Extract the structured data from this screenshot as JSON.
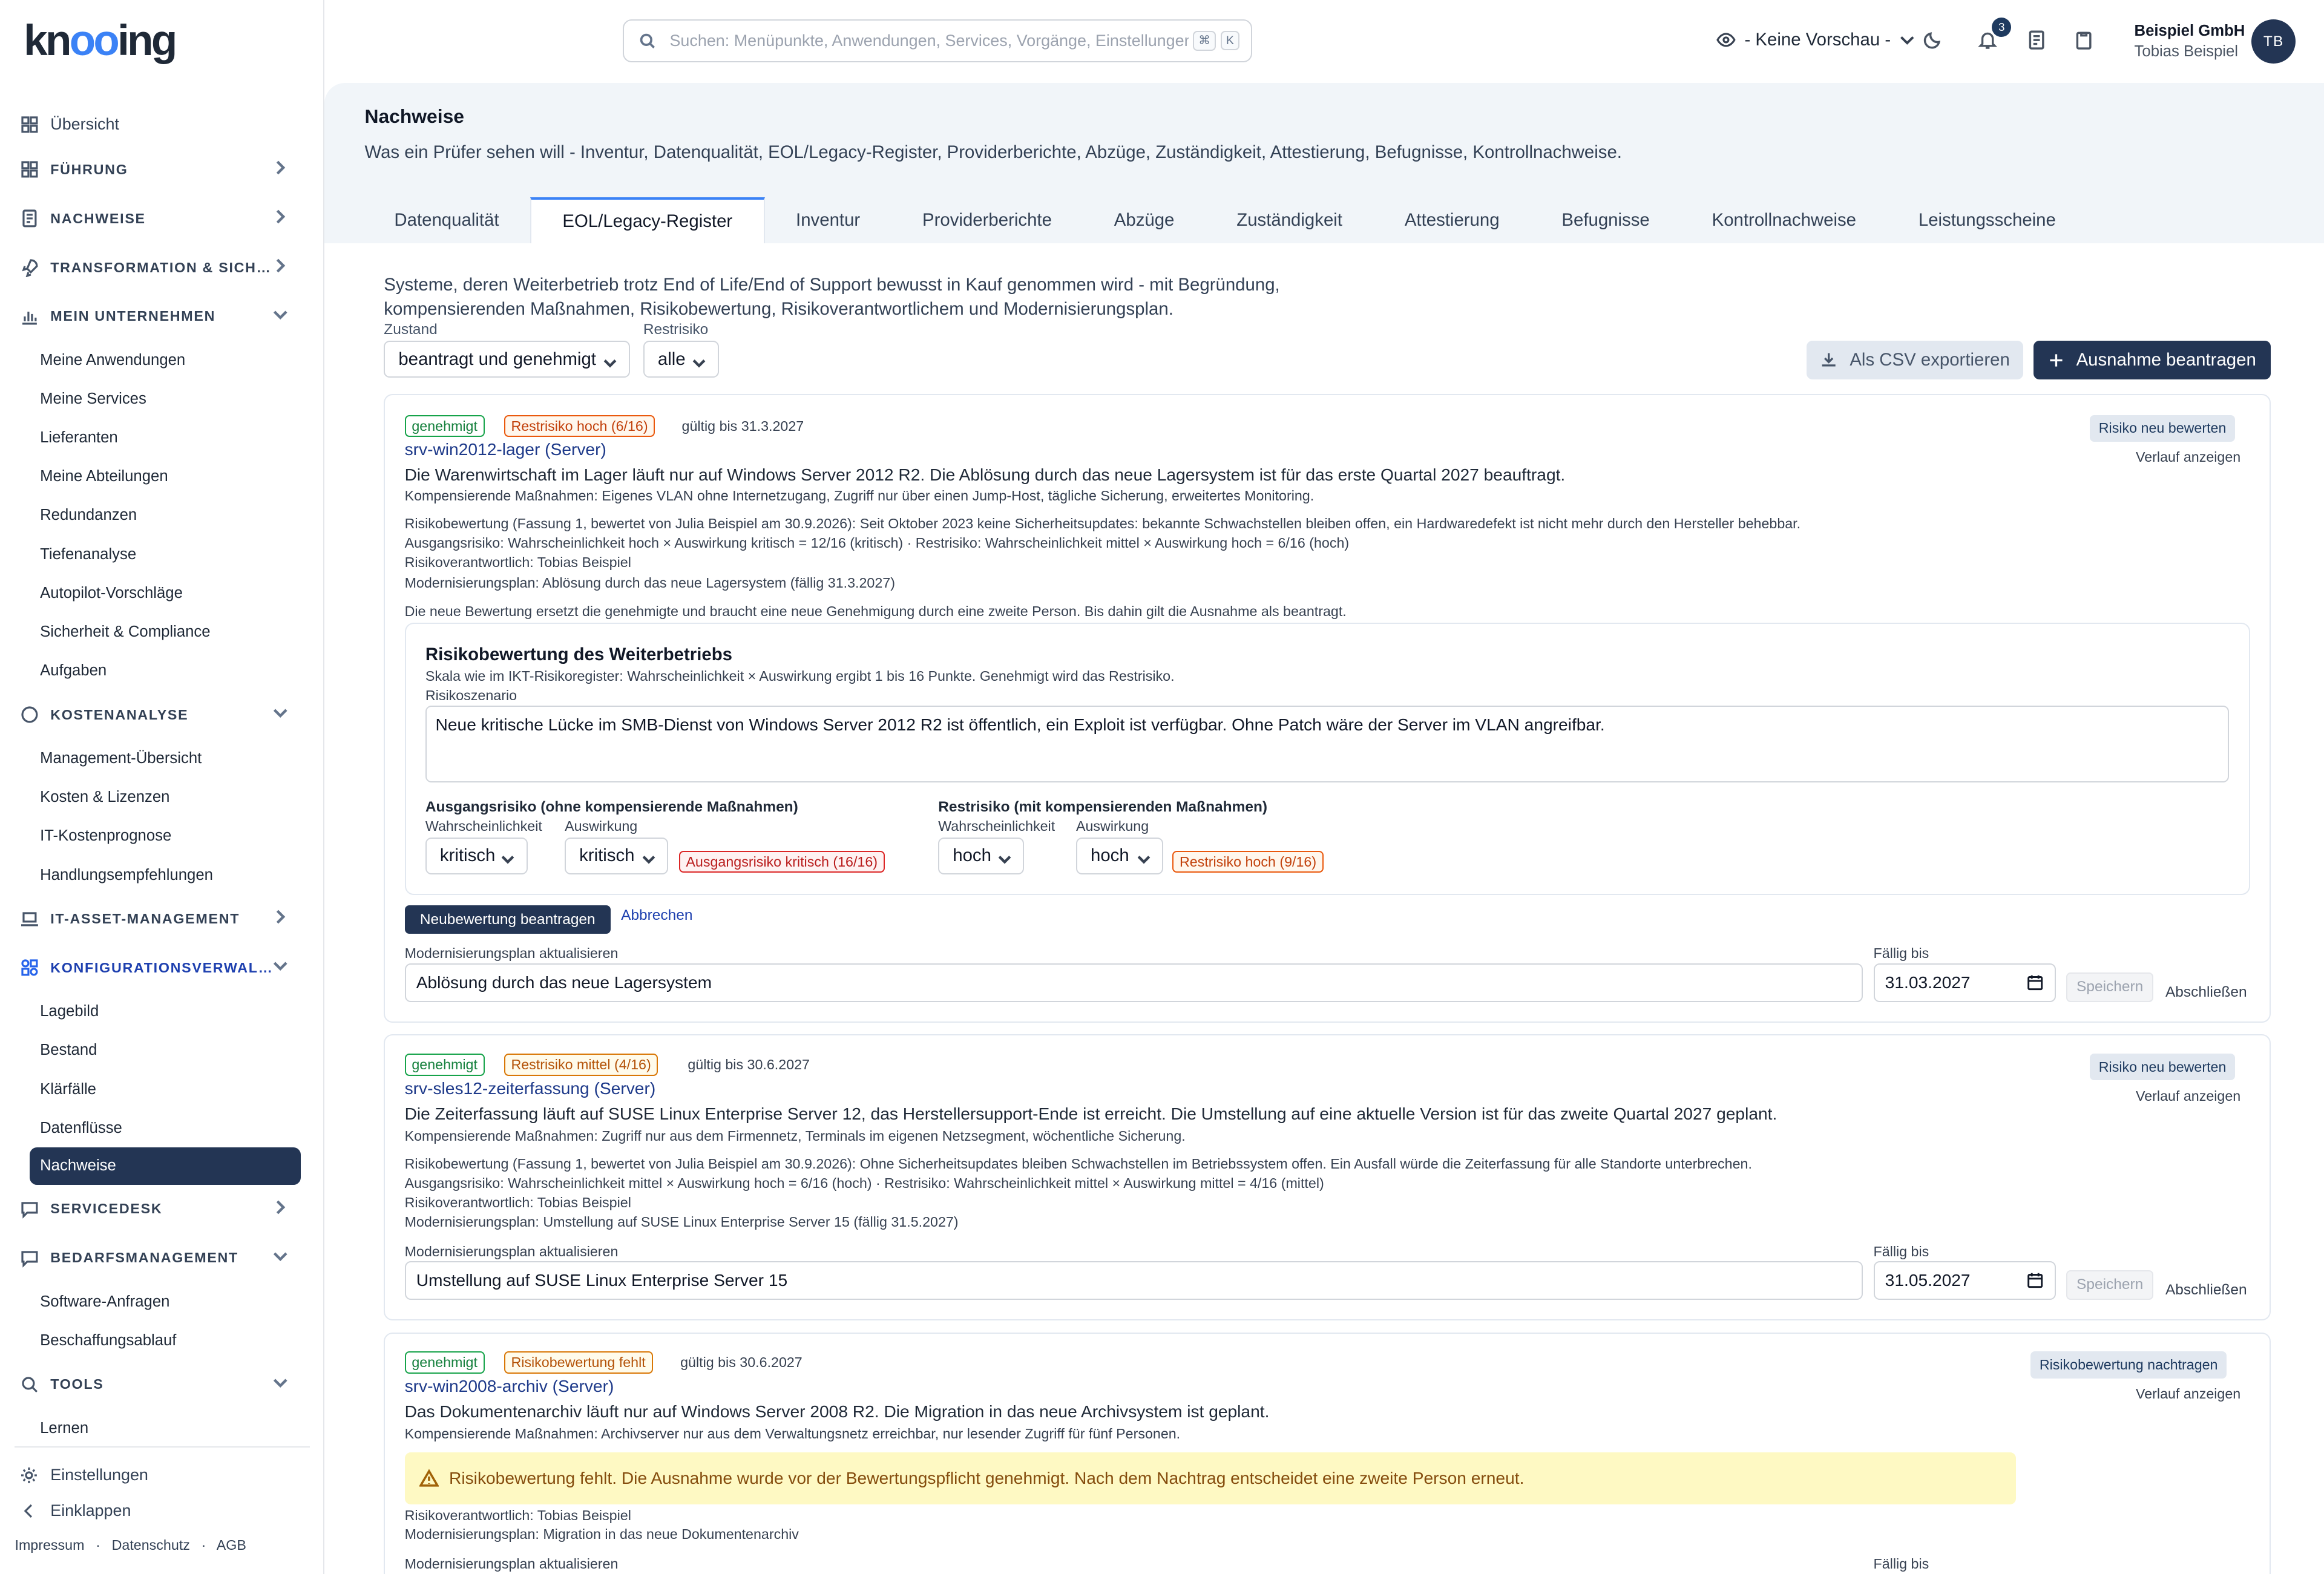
{
  "app": {
    "logo": "knooing"
  },
  "header": {
    "search_placeholder": "Suchen: Menüpunkte, Anwendungen, Services, Vorgänge, Einstellungen",
    "kbd1": "⌘",
    "kbd2": "K",
    "preview": "- Keine Vorschau -",
    "notifications_count": "3",
    "company": "Beispiel GmbH",
    "user": "Tobias Beispiel",
    "initials": "TB"
  },
  "sidebar": {
    "overview": "Übersicht",
    "fuehrung": "Führung",
    "nachweise": "Nachweise",
    "transformation": "Transformation & Sich…",
    "unternehmen": "Mein Unternehmen",
    "unternehmen_items": [
      "Meine Anwendungen",
      "Meine Services",
      "Lieferanten",
      "Meine Abteilungen",
      "Redundanzen",
      "Tiefenanalyse",
      "Autopilot-Vorschläge",
      "Sicherheit & Compliance",
      "Aufgaben"
    ],
    "kosten": "Kostenanalyse",
    "kosten_items": [
      "Management-Übersicht",
      "Kosten & Lizenzen",
      "IT-Kostenprognose",
      "Handlungsempfehlungen"
    ],
    "itam": "IT-Asset-Management",
    "konfig": "Konfigurationsverwal…",
    "konfig_items": [
      "Lagebild",
      "Bestand",
      "Klärfälle",
      "Datenflüsse",
      "Nachweise"
    ],
    "servicedesk": "Servicedesk",
    "bedarf": "Bedarfsmanagement",
    "bedarf_items": [
      "Software-Anfragen",
      "Beschaffungsablauf"
    ],
    "tools": "Tools",
    "tools_items": [
      "Lernen"
    ],
    "settings": "Einstellungen",
    "collapse": "Einklappen",
    "legal": [
      "Impressum",
      "Datenschutz",
      "AGB"
    ]
  },
  "page": {
    "title": "Nachweise",
    "subtitle": "Was ein Prüfer sehen will - Inventur, Datenqualität, EOL/Legacy-Register, Providerberichte, Abzüge, Zuständigkeit, Attestierung, Befugnisse, Kontrollnachweise.",
    "tabs": [
      "Datenqualität",
      "EOL/Legacy-Register",
      "Inventur",
      "Providerberichte",
      "Abzüge",
      "Zuständigkeit",
      "Attestierung",
      "Befugnisse",
      "Kontrollnachweise",
      "Leistungsscheine"
    ],
    "active_tab": 1,
    "description_line1": "Systeme, deren Weiterbetrieb trotz End of Life/End of Support bewusst in Kauf genommen wird - mit Begründung,",
    "description_line2": "kompensierenden Maßnahmen, Risikobewertung, Risikoverantwortlichem und Modernisierungsplan.",
    "filter_zustand_label": "Zustand",
    "filter_zustand_value": "beantragt und genehmigt",
    "filter_rest_label": "Restrisiko",
    "filter_rest_value": "alle",
    "export_label": "Als CSV exportieren",
    "request_label": "Ausnahme beantragen"
  },
  "cards": [
    {
      "status": "genehmigt",
      "risk_tag": "Restrisiko hoch (6/16)",
      "valid": "gültig bis 31.3.2027",
      "title": "srv-win2012-lager (Server)",
      "main": "Die Warenwirtschaft im Lager läuft nur auf Windows Server 2012 R2. Die Ablösung durch das neue Lagersystem ist für das erste Quartal 2027 beauftragt.",
      "measures": "Kompensierende Maßnahmen: Eigenes VLAN ohne Internetzugang, Zugriff nur über einen Jump-Host, tägliche Sicherung, erweitertes Monitoring.",
      "assessment": "Risikobewertung (Fassung 1, bewertet von Julia Beispiel am 30.9.2026): Seit Oktober 2023 keine Sicherheitsupdates: bekannte Schwachstellen bleiben offen, ein Hardwaredefekt ist nicht mehr durch den Hersteller behebbar.",
      "risk_calc": "Ausgangsrisiko: Wahrscheinlichkeit hoch × Auswirkung kritisch = 12/16 (kritisch) · Restrisiko: Wahrscheinlichkeit mittel × Auswirkung hoch = 6/16 (hoch)",
      "owner": "Risikoverantwortlich: Tobias Beispiel",
      "plan": "Modernisierungsplan: Ablösung durch das neue Lagersystem (fällig 31.3.2027)",
      "note": "Die neue Bewertung ersetzt die genehmigte und braucht eine neue Genehmigung durch eine zweite Person. Bis dahin gilt die Ausnahme als beantragt.",
      "action": "Risiko neu bewerten",
      "history": "Verlauf anzeigen",
      "plan_label": "Modernisierungsplan aktualisieren",
      "plan_value": "Ablösung durch das neue Lagersystem",
      "due_label": "Fällig bis",
      "due_value": "31.03.2027",
      "save": "Speichern",
      "close": "Abschließen"
    },
    {
      "status": "genehmigt",
      "risk_tag": "Restrisiko mittel (4/16)",
      "valid": "gültig bis 30.6.2027",
      "title": "srv-sles12-zeiterfassung (Server)",
      "main": "Die Zeiterfassung läuft auf SUSE Linux Enterprise Server 12, das Herstellersupport-Ende ist erreicht. Die Umstellung auf eine aktuelle Version ist für das zweite Quartal 2027 geplant.",
      "measures": "Kompensierende Maßnahmen: Zugriff nur aus dem Firmennetz, Terminals im eigenen Netzsegment, wöchentliche Sicherung.",
      "assessment": "Risikobewertung (Fassung 1, bewertet von Julia Beispiel am 30.9.2026): Ohne Sicherheitsupdates bleiben Schwachstellen im Betriebssystem offen. Ein Ausfall würde die Zeiterfassung für alle Standorte unterbrechen.",
      "risk_calc": "Ausgangsrisiko: Wahrscheinlichkeit mittel × Auswirkung hoch = 6/16 (hoch) · Restrisiko: Wahrscheinlichkeit mittel × Auswirkung mittel = 4/16 (mittel)",
      "owner": "Risikoverantwortlich: Tobias Beispiel",
      "plan": "Modernisierungsplan: Umstellung auf SUSE Linux Enterprise Server 15 (fällig 31.5.2027)",
      "action": "Risiko neu bewerten",
      "history": "Verlauf anzeigen",
      "plan_label": "Modernisierungsplan aktualisieren",
      "plan_value": "Umstellung auf SUSE Linux Enterprise Server 15",
      "due_label": "Fällig bis",
      "due_value": "31.05.2027",
      "save": "Speichern",
      "close": "Abschließen"
    },
    {
      "status": "genehmigt",
      "risk_tag": "Risikobewertung fehlt",
      "valid": "gültig bis 30.6.2027",
      "title": "srv-win2008-archiv (Server)",
      "main": "Das Dokumentenarchiv läuft nur auf Windows Server 2008 R2. Die Migration in das neue Archivsystem ist geplant.",
      "measures": "Kompensierende Maßnahmen: Archivserver nur aus dem Verwaltungsnetz erreichbar, nur lesender Zugriff für fünf Personen.",
      "warning": "Risikobewertung fehlt. Die Ausnahme wurde vor der Bewertungspflicht genehmigt. Nach dem Nachtrag entscheidet eine zweite Person erneut.",
      "owner": "Risikoverantwortlich: Tobias Beispiel",
      "plan": "Modernisierungsplan: Migration in das neue Dokumentenarchiv",
      "action": "Risikobewertung nachtragen",
      "history": "Verlauf anzeigen",
      "plan_label": "Modernisierungsplan aktualisieren",
      "due_label": "Fällig bis"
    }
  ],
  "reassess": {
    "title": "Risikobewertung des Weiterbetriebs",
    "scale": "Skala wie im IKT-Risikoregister: Wahrscheinlichkeit × Auswirkung ergibt 1 bis 16 Punkte. Genehmigt wird das Restrisiko.",
    "scenario_label": "Risikoszenario",
    "scenario": "Neue kritische Lücke im SMB-Dienst von Windows Server 2012 R2 ist öffentlich, ein Exploit ist verfügbar. Ohne Patch wäre der Server im VLAN angreifbar.",
    "initial_title": "Ausgangsrisiko (ohne kompensierende Maßnahmen)",
    "residual_title": "Restrisiko (mit kompensierenden Maßnahmen)",
    "prob_label": "Wahrscheinlichkeit",
    "impact_label": "Auswirkung",
    "initial_prob": "kritisch",
    "initial_impact": "kritisch",
    "initial_result": "Ausgangsrisiko kritisch (16/16)",
    "residual_prob": "hoch",
    "residual_impact": "hoch",
    "residual_result": "Restrisiko hoch (9/16)",
    "submit": "Neubewertung beantragen",
    "cancel": "Abbrechen"
  }
}
